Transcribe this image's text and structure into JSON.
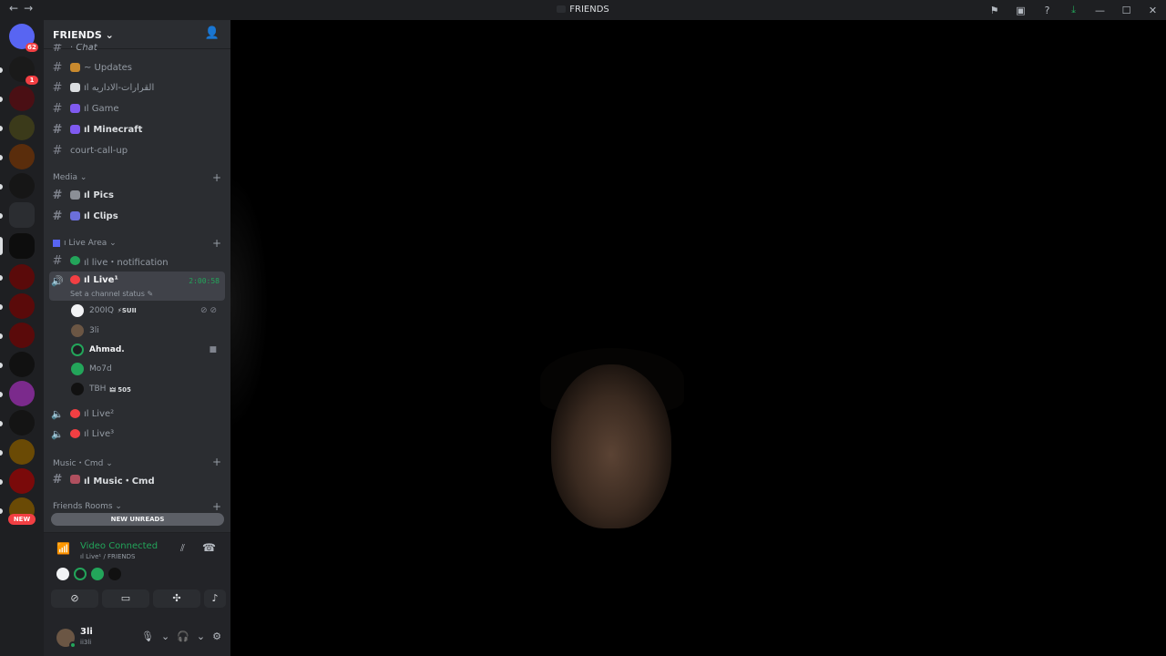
{
  "titlebar": {
    "back": "←",
    "forward": "→",
    "title": "FRIENDS",
    "tools": [
      "⚑",
      "▣",
      "?",
      "⤓"
    ],
    "window_buttons": [
      "—",
      "☐",
      "✕"
    ]
  },
  "guild_bar": {
    "dm_badge": "62",
    "stars_badge": "1",
    "new_pill": "NEW"
  },
  "server": {
    "name": "FRIENDS ⌄",
    "invite_icon": "👤"
  },
  "channels": {
    "partial_top": "· 𝘊𝘩𝘢𝘵",
    "updates": "~ Updates",
    "decisions": "ıl القرارات-الاداريه",
    "game": "ıl Game",
    "minecraft": "ıl 𝗠𝗶𝗻𝗲𝗰𝗿𝗮𝗳𝘁",
    "court": "court-call-up",
    "media_cat": "Media ⌄",
    "pics": "ıl 𝗣𝗶𝗰𝘀",
    "clips": "ıl 𝗖𝗹𝗶𝗽𝘀",
    "live_area_cat": "ı Live Area ⌄",
    "live_notification": "ıl live・notification",
    "live1": "ıl Live¹",
    "live1_timer": "2:00:58",
    "live1_status": "Set a channel status ✎",
    "live2": "ıl Live²",
    "live3": "ıl Live³",
    "music_cat": "Music・Cmd ⌄",
    "music": "ıl 𝗠𝘂𝘀𝗶𝗰・𝗖𝗺𝗱",
    "friends_rooms_cat": "Friends Rooms ⌄",
    "new_unreads": "NEW UNREADS"
  },
  "voice_users": [
    {
      "name": "200IQ",
      "tag": "⚡SUII",
      "color": "#f2f3f5"
    },
    {
      "name": "3li",
      "tag": "",
      "color": "#6b5644"
    },
    {
      "name": "Ahmad.",
      "tag": "",
      "color": "#1e1f22"
    },
    {
      "name": "Mo7d",
      "tag": "",
      "color": "#23a55a"
    },
    {
      "name": "TBH",
      "tag": "🜲 505",
      "color": "#111"
    }
  ],
  "voice_panel": {
    "status": "Video Connected",
    "location": "ıl Live¹ / FRIENDS"
  },
  "user": {
    "name": "3li",
    "status": "ii3li"
  },
  "colors": {
    "accent_green": "#23a55a",
    "badge_red": "#f23f43",
    "sidebar_bg": "#2b2d31",
    "rail_bg": "#1e1f22"
  }
}
